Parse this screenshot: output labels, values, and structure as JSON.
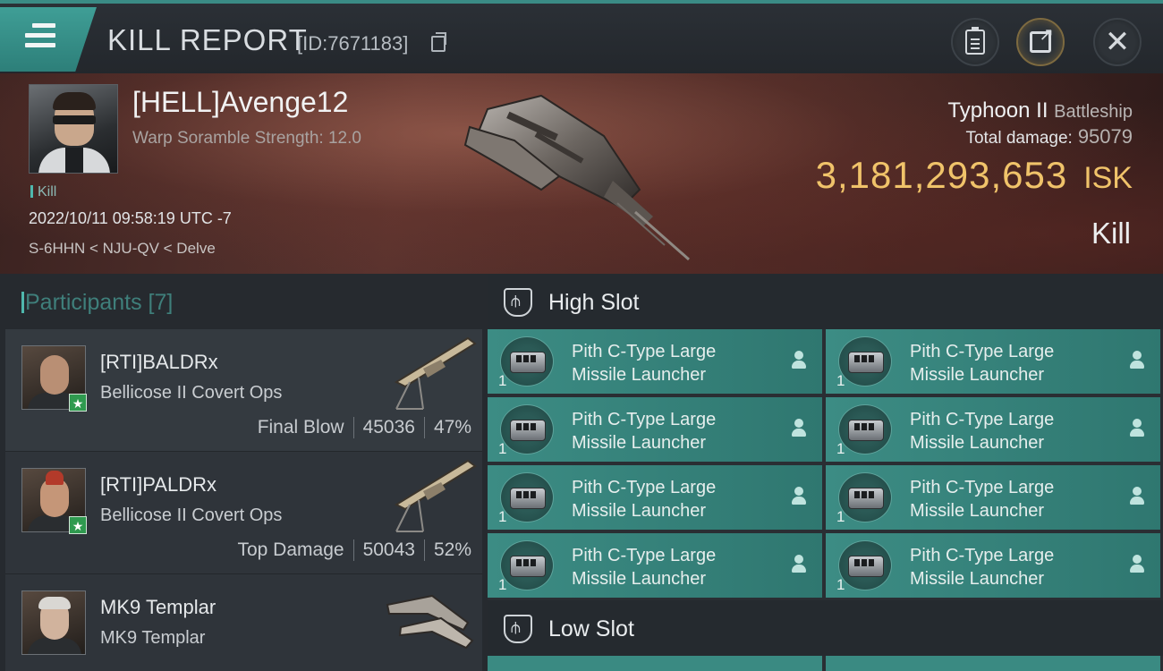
{
  "header": {
    "title": "KILL REPORT",
    "report_id": "[ID:7671183]",
    "icons": [
      "menu-icon",
      "copy-icon",
      "clipboard-icon",
      "share-icon",
      "close-icon"
    ]
  },
  "victim": {
    "name": "[HELL]Avenge12",
    "subtitle": "Warp Soramble Strength: 12.0",
    "tag": "Kill",
    "datetime": "2022/10/11 09:58:19 UTC -7",
    "location": "S-6HHN < NJU-QV < Delve",
    "ship_name": "Typhoon II",
    "ship_class": "Battleship",
    "total_damage_label": "Total damage:",
    "total_damage": "95079",
    "isk_value": "3,181,293,653",
    "isk_unit": "ISK",
    "result": "Kill"
  },
  "participants": {
    "title": "Participants [7]",
    "rows": [
      {
        "name": "[RTI]BALDRx",
        "ship": "Bellicose II Covert Ops",
        "stat_label": "Final Blow",
        "damage": "45036",
        "percent": "47%"
      },
      {
        "name": "[RTI]PALDRx",
        "ship": "Bellicose II Covert Ops",
        "stat_label": "Top Damage",
        "damage": "50043",
        "percent": "52%"
      },
      {
        "name": "MK9 Templar",
        "ship": "MK9 Templar"
      }
    ]
  },
  "slots": {
    "high_label": "High Slot",
    "low_label": "Low Slot",
    "module_line1": "Pith C-Type Large",
    "module_line2": "Missile Launcher",
    "module_qty": "1"
  },
  "colors": {
    "accent_teal": "#3c8c84",
    "isk_gold": "#f0c36a",
    "badge_green": "#2f9a4f"
  }
}
